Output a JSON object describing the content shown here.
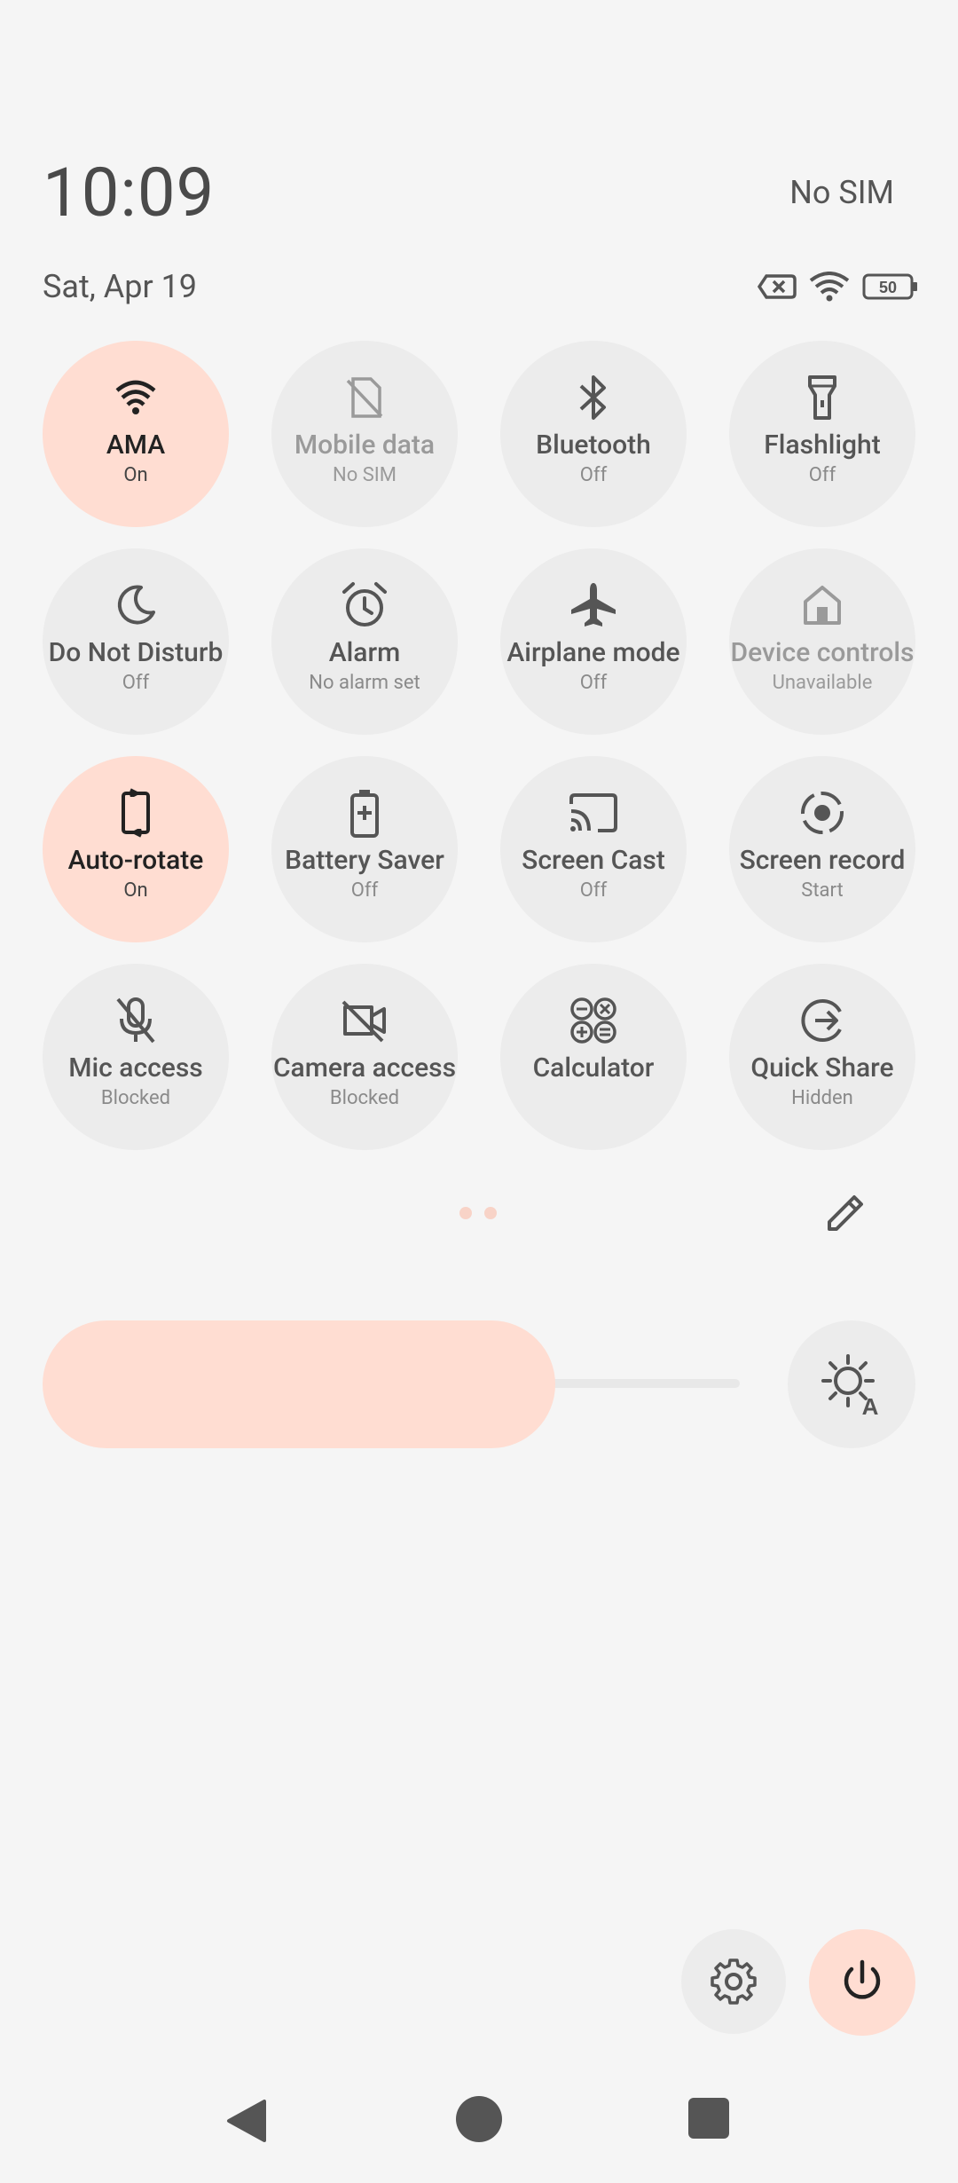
{
  "header": {
    "time": "10:09",
    "carrier": "No SIM",
    "date": "Sat, Apr 19",
    "battery_level": "50"
  },
  "tiles": [
    {
      "icon": "wifi-icon",
      "label": "AMA",
      "sub": "On",
      "state": "on"
    },
    {
      "icon": "mobile-data-off-icon",
      "label": "Mobile data",
      "sub": "No SIM",
      "state": "dim"
    },
    {
      "icon": "bluetooth-icon",
      "label": "Bluetooth",
      "sub": "Off",
      "state": "off"
    },
    {
      "icon": "flashlight-icon",
      "label": "Flashlight",
      "sub": "Off",
      "state": "off"
    },
    {
      "icon": "moon-icon",
      "label": "Do Not Disturb",
      "sub": "Off",
      "state": "off"
    },
    {
      "icon": "alarm-icon",
      "label": "Alarm",
      "sub": "No alarm set",
      "state": "off"
    },
    {
      "icon": "airplane-icon",
      "label": "Airplane mode",
      "sub": "Off",
      "state": "off"
    },
    {
      "icon": "home-icon",
      "label": "Device controls",
      "sub": "Unavailable",
      "state": "dim"
    },
    {
      "icon": "rotate-icon",
      "label": "Auto-rotate",
      "sub": "On",
      "state": "on"
    },
    {
      "icon": "battery-saver-icon",
      "label": "Battery Saver",
      "sub": "Off",
      "state": "off"
    },
    {
      "icon": "cast-icon",
      "label": "Screen Cast",
      "sub": "Off",
      "state": "off"
    },
    {
      "icon": "screen-record-icon",
      "label": "Screen record",
      "sub": "Start",
      "state": "off"
    },
    {
      "icon": "mic-off-icon",
      "label": "Mic access",
      "sub": "Blocked",
      "state": "off"
    },
    {
      "icon": "camera-off-icon",
      "label": "Camera access",
      "sub": "Blocked",
      "state": "off"
    },
    {
      "icon": "calculator-icon",
      "label": "Calculator",
      "sub": "",
      "state": "off"
    },
    {
      "icon": "quick-share-icon",
      "label": "Quick Share",
      "sub": "Hidden",
      "state": "off"
    }
  ],
  "brightness_level": 0.74,
  "colors": {
    "accent": "#ffddd2",
    "tile_off": "#ececec",
    "background": "#f5f5f5"
  }
}
